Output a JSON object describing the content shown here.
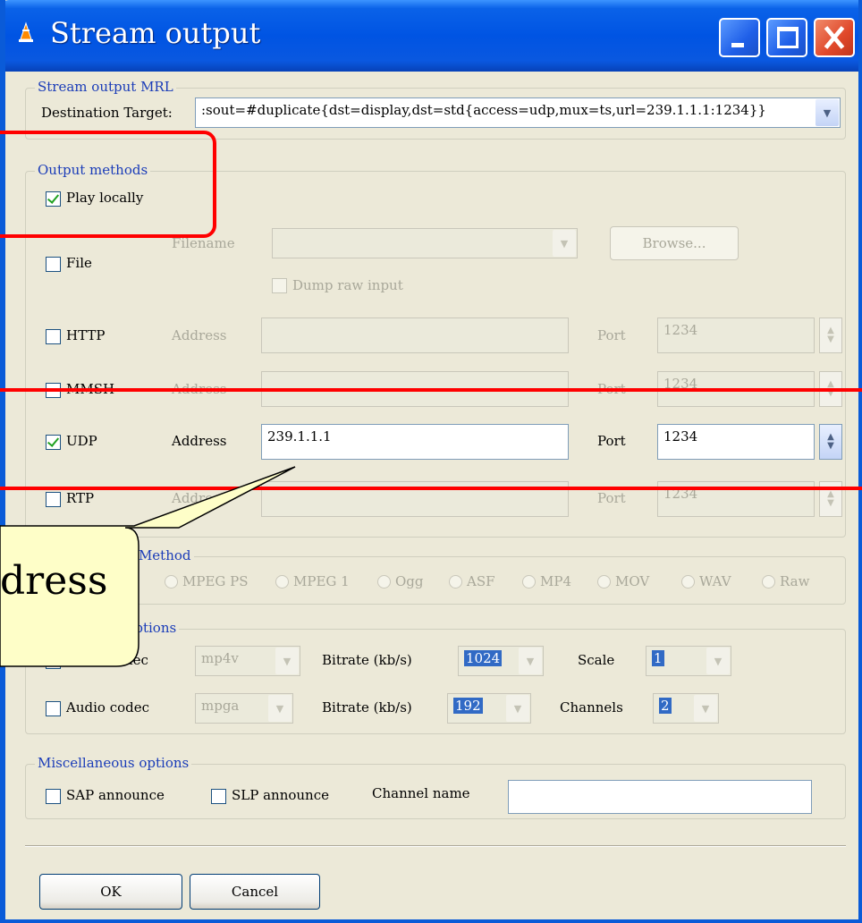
{
  "window": {
    "title": "Stream output"
  },
  "mrl": {
    "legend": "Stream output MRL",
    "destination_label": "Destination Target:",
    "destination_value": ":sout=#duplicate{dst=display,dst=std{access=udp,mux=ts,url=239.1.1.1:1234}}"
  },
  "output_methods": {
    "legend": "Output methods",
    "play_locally": "Play locally",
    "file": "File",
    "filename_label": "Filename",
    "browse": "Browse...",
    "dump_raw": "Dump raw input",
    "http": "HTTP",
    "mmsh": "MMSH",
    "udp": "UDP",
    "rtp": "RTP",
    "address_label": "Address",
    "port_label": "Port",
    "http_port": "1234",
    "mmsh_port": "1234",
    "udp_address": "239.1.1.1",
    "udp_port": "1234",
    "rtp_port": "1234"
  },
  "encapsulation": {
    "legend": "Encapsulation Method",
    "options": [
      "MPEG PS",
      "MPEG 1",
      "Ogg",
      "ASF",
      "MP4",
      "MOV",
      "WAV",
      "Raw"
    ]
  },
  "transcode": {
    "legend": "Transcoding options",
    "video_codec_label": "Video codec",
    "video_codec": "mp4v",
    "video_bitrate_label": "Bitrate (kb/s)",
    "video_bitrate": "1024",
    "scale_label": "Scale",
    "scale": "1",
    "audio_codec_label": "Audio codec",
    "audio_codec": "mpga",
    "audio_bitrate_label": "Bitrate (kb/s)",
    "audio_bitrate": "192",
    "channels_label": "Channels",
    "channels": "2"
  },
  "misc": {
    "legend": "Miscellaneous options",
    "sap": "SAP announce",
    "slp": "SLP announce",
    "channel_name_label": "Channel name"
  },
  "buttons": {
    "ok": "OK",
    "cancel": "Cancel"
  },
  "callout": {
    "text": "dress"
  },
  "colors": {
    "title_blue": "#0054e3",
    "annotation_red": "#ff0000",
    "callout_yellow": "#fefec8"
  }
}
